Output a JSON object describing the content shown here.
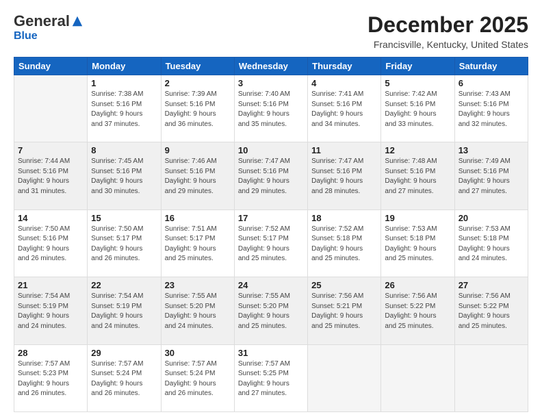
{
  "header": {
    "logo_general": "General",
    "logo_blue": "Blue",
    "month_title": "December 2025",
    "location": "Francisville, Kentucky, United States"
  },
  "days_of_week": [
    "Sunday",
    "Monday",
    "Tuesday",
    "Wednesday",
    "Thursday",
    "Friday",
    "Saturday"
  ],
  "weeks": [
    [
      {
        "day": "",
        "info": ""
      },
      {
        "day": "1",
        "info": "Sunrise: 7:38 AM\nSunset: 5:16 PM\nDaylight: 9 hours\nand 37 minutes."
      },
      {
        "day": "2",
        "info": "Sunrise: 7:39 AM\nSunset: 5:16 PM\nDaylight: 9 hours\nand 36 minutes."
      },
      {
        "day": "3",
        "info": "Sunrise: 7:40 AM\nSunset: 5:16 PM\nDaylight: 9 hours\nand 35 minutes."
      },
      {
        "day": "4",
        "info": "Sunrise: 7:41 AM\nSunset: 5:16 PM\nDaylight: 9 hours\nand 34 minutes."
      },
      {
        "day": "5",
        "info": "Sunrise: 7:42 AM\nSunset: 5:16 PM\nDaylight: 9 hours\nand 33 minutes."
      },
      {
        "day": "6",
        "info": "Sunrise: 7:43 AM\nSunset: 5:16 PM\nDaylight: 9 hours\nand 32 minutes."
      }
    ],
    [
      {
        "day": "7",
        "info": "Sunrise: 7:44 AM\nSunset: 5:16 PM\nDaylight: 9 hours\nand 31 minutes."
      },
      {
        "day": "8",
        "info": "Sunrise: 7:45 AM\nSunset: 5:16 PM\nDaylight: 9 hours\nand 30 minutes."
      },
      {
        "day": "9",
        "info": "Sunrise: 7:46 AM\nSunset: 5:16 PM\nDaylight: 9 hours\nand 29 minutes."
      },
      {
        "day": "10",
        "info": "Sunrise: 7:47 AM\nSunset: 5:16 PM\nDaylight: 9 hours\nand 29 minutes."
      },
      {
        "day": "11",
        "info": "Sunrise: 7:47 AM\nSunset: 5:16 PM\nDaylight: 9 hours\nand 28 minutes."
      },
      {
        "day": "12",
        "info": "Sunrise: 7:48 AM\nSunset: 5:16 PM\nDaylight: 9 hours\nand 27 minutes."
      },
      {
        "day": "13",
        "info": "Sunrise: 7:49 AM\nSunset: 5:16 PM\nDaylight: 9 hours\nand 27 minutes."
      }
    ],
    [
      {
        "day": "14",
        "info": "Sunrise: 7:50 AM\nSunset: 5:16 PM\nDaylight: 9 hours\nand 26 minutes."
      },
      {
        "day": "15",
        "info": "Sunrise: 7:50 AM\nSunset: 5:17 PM\nDaylight: 9 hours\nand 26 minutes."
      },
      {
        "day": "16",
        "info": "Sunrise: 7:51 AM\nSunset: 5:17 PM\nDaylight: 9 hours\nand 25 minutes."
      },
      {
        "day": "17",
        "info": "Sunrise: 7:52 AM\nSunset: 5:17 PM\nDaylight: 9 hours\nand 25 minutes."
      },
      {
        "day": "18",
        "info": "Sunrise: 7:52 AM\nSunset: 5:18 PM\nDaylight: 9 hours\nand 25 minutes."
      },
      {
        "day": "19",
        "info": "Sunrise: 7:53 AM\nSunset: 5:18 PM\nDaylight: 9 hours\nand 25 minutes."
      },
      {
        "day": "20",
        "info": "Sunrise: 7:53 AM\nSunset: 5:18 PM\nDaylight: 9 hours\nand 24 minutes."
      }
    ],
    [
      {
        "day": "21",
        "info": "Sunrise: 7:54 AM\nSunset: 5:19 PM\nDaylight: 9 hours\nand 24 minutes."
      },
      {
        "day": "22",
        "info": "Sunrise: 7:54 AM\nSunset: 5:19 PM\nDaylight: 9 hours\nand 24 minutes."
      },
      {
        "day": "23",
        "info": "Sunrise: 7:55 AM\nSunset: 5:20 PM\nDaylight: 9 hours\nand 24 minutes."
      },
      {
        "day": "24",
        "info": "Sunrise: 7:55 AM\nSunset: 5:20 PM\nDaylight: 9 hours\nand 25 minutes."
      },
      {
        "day": "25",
        "info": "Sunrise: 7:56 AM\nSunset: 5:21 PM\nDaylight: 9 hours\nand 25 minutes."
      },
      {
        "day": "26",
        "info": "Sunrise: 7:56 AM\nSunset: 5:22 PM\nDaylight: 9 hours\nand 25 minutes."
      },
      {
        "day": "27",
        "info": "Sunrise: 7:56 AM\nSunset: 5:22 PM\nDaylight: 9 hours\nand 25 minutes."
      }
    ],
    [
      {
        "day": "28",
        "info": "Sunrise: 7:57 AM\nSunset: 5:23 PM\nDaylight: 9 hours\nand 26 minutes."
      },
      {
        "day": "29",
        "info": "Sunrise: 7:57 AM\nSunset: 5:24 PM\nDaylight: 9 hours\nand 26 minutes."
      },
      {
        "day": "30",
        "info": "Sunrise: 7:57 AM\nSunset: 5:24 PM\nDaylight: 9 hours\nand 26 minutes."
      },
      {
        "day": "31",
        "info": "Sunrise: 7:57 AM\nSunset: 5:25 PM\nDaylight: 9 hours\nand 27 minutes."
      },
      {
        "day": "",
        "info": ""
      },
      {
        "day": "",
        "info": ""
      },
      {
        "day": "",
        "info": ""
      }
    ]
  ]
}
